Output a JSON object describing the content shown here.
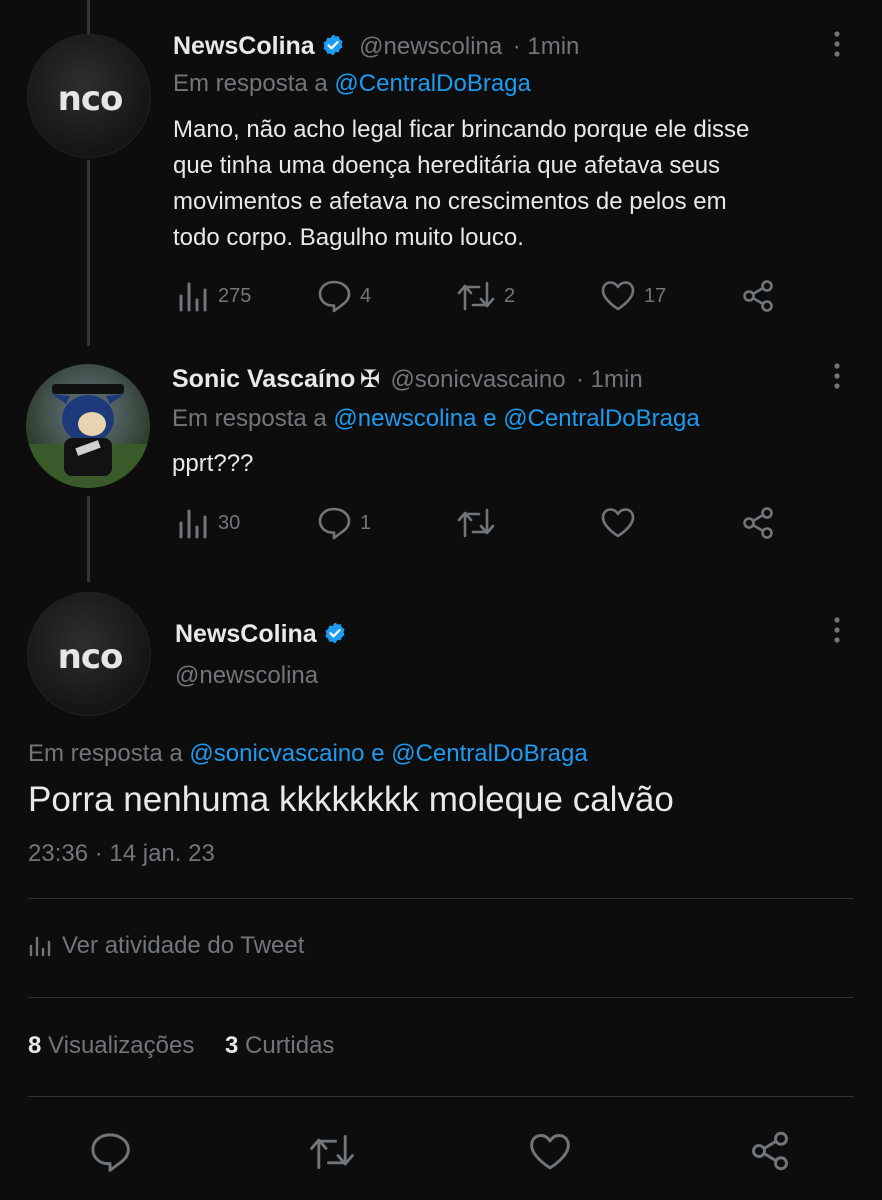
{
  "tweet1": {
    "author_name": "NewsColina",
    "handle": "@newscolina",
    "time": "· 1min",
    "reply_prefix": "Em resposta a",
    "reply_to": "@CentralDoBraga",
    "text_lines": [
      "Mano, não acho legal ficar brincando porque ele disse",
      "que tinha uma doença hereditária que afetava seus",
      "movimentos e afetava no crescimentos de pelos em",
      "todo corpo. Bagulho muito louco."
    ],
    "stats": {
      "views": "275",
      "replies": "4",
      "retweets": "2",
      "likes": "17"
    }
  },
  "tweet2": {
    "author_name": "Sonic Vascaíno",
    "author_symbol": "✠",
    "handle": "@sonicvascaino",
    "time": "· 1min",
    "reply_prefix": "Em resposta a",
    "reply_to_1": "@newscolina",
    "reply_joiner": "e",
    "reply_to_2": "@CentralDoBraga",
    "text": "pprt???",
    "stats": {
      "views": "30",
      "replies": "1",
      "retweets": "",
      "likes": ""
    }
  },
  "main_tweet": {
    "author_name": "NewsColina",
    "handle": "@newscolina",
    "reply_prefix": "Em resposta a",
    "reply_to_1": "@sonicvascaino",
    "reply_joiner": "e",
    "reply_to_2": "@CentralDoBraga",
    "text": "Porra nenhuma kkkkkkkk moleque calvão",
    "timestamp": "23:36 · 14 jan. 23",
    "activity_label": "Ver atividade do Tweet",
    "views_count": "8",
    "views_label": "Visualizações",
    "likes_count": "3",
    "likes_label": "Curtidas"
  },
  "avatar_text": "nco",
  "icons": [
    "verified-badge-icon",
    "more-icon",
    "views-icon",
    "reply-icon",
    "retweet-icon",
    "like-icon",
    "share-icon"
  ],
  "colors": {
    "background": "#0d0d0d",
    "text": "#e7e9ea",
    "muted": "#71767b",
    "link": "#1d9bf0",
    "verified": "#1d9bf0"
  }
}
